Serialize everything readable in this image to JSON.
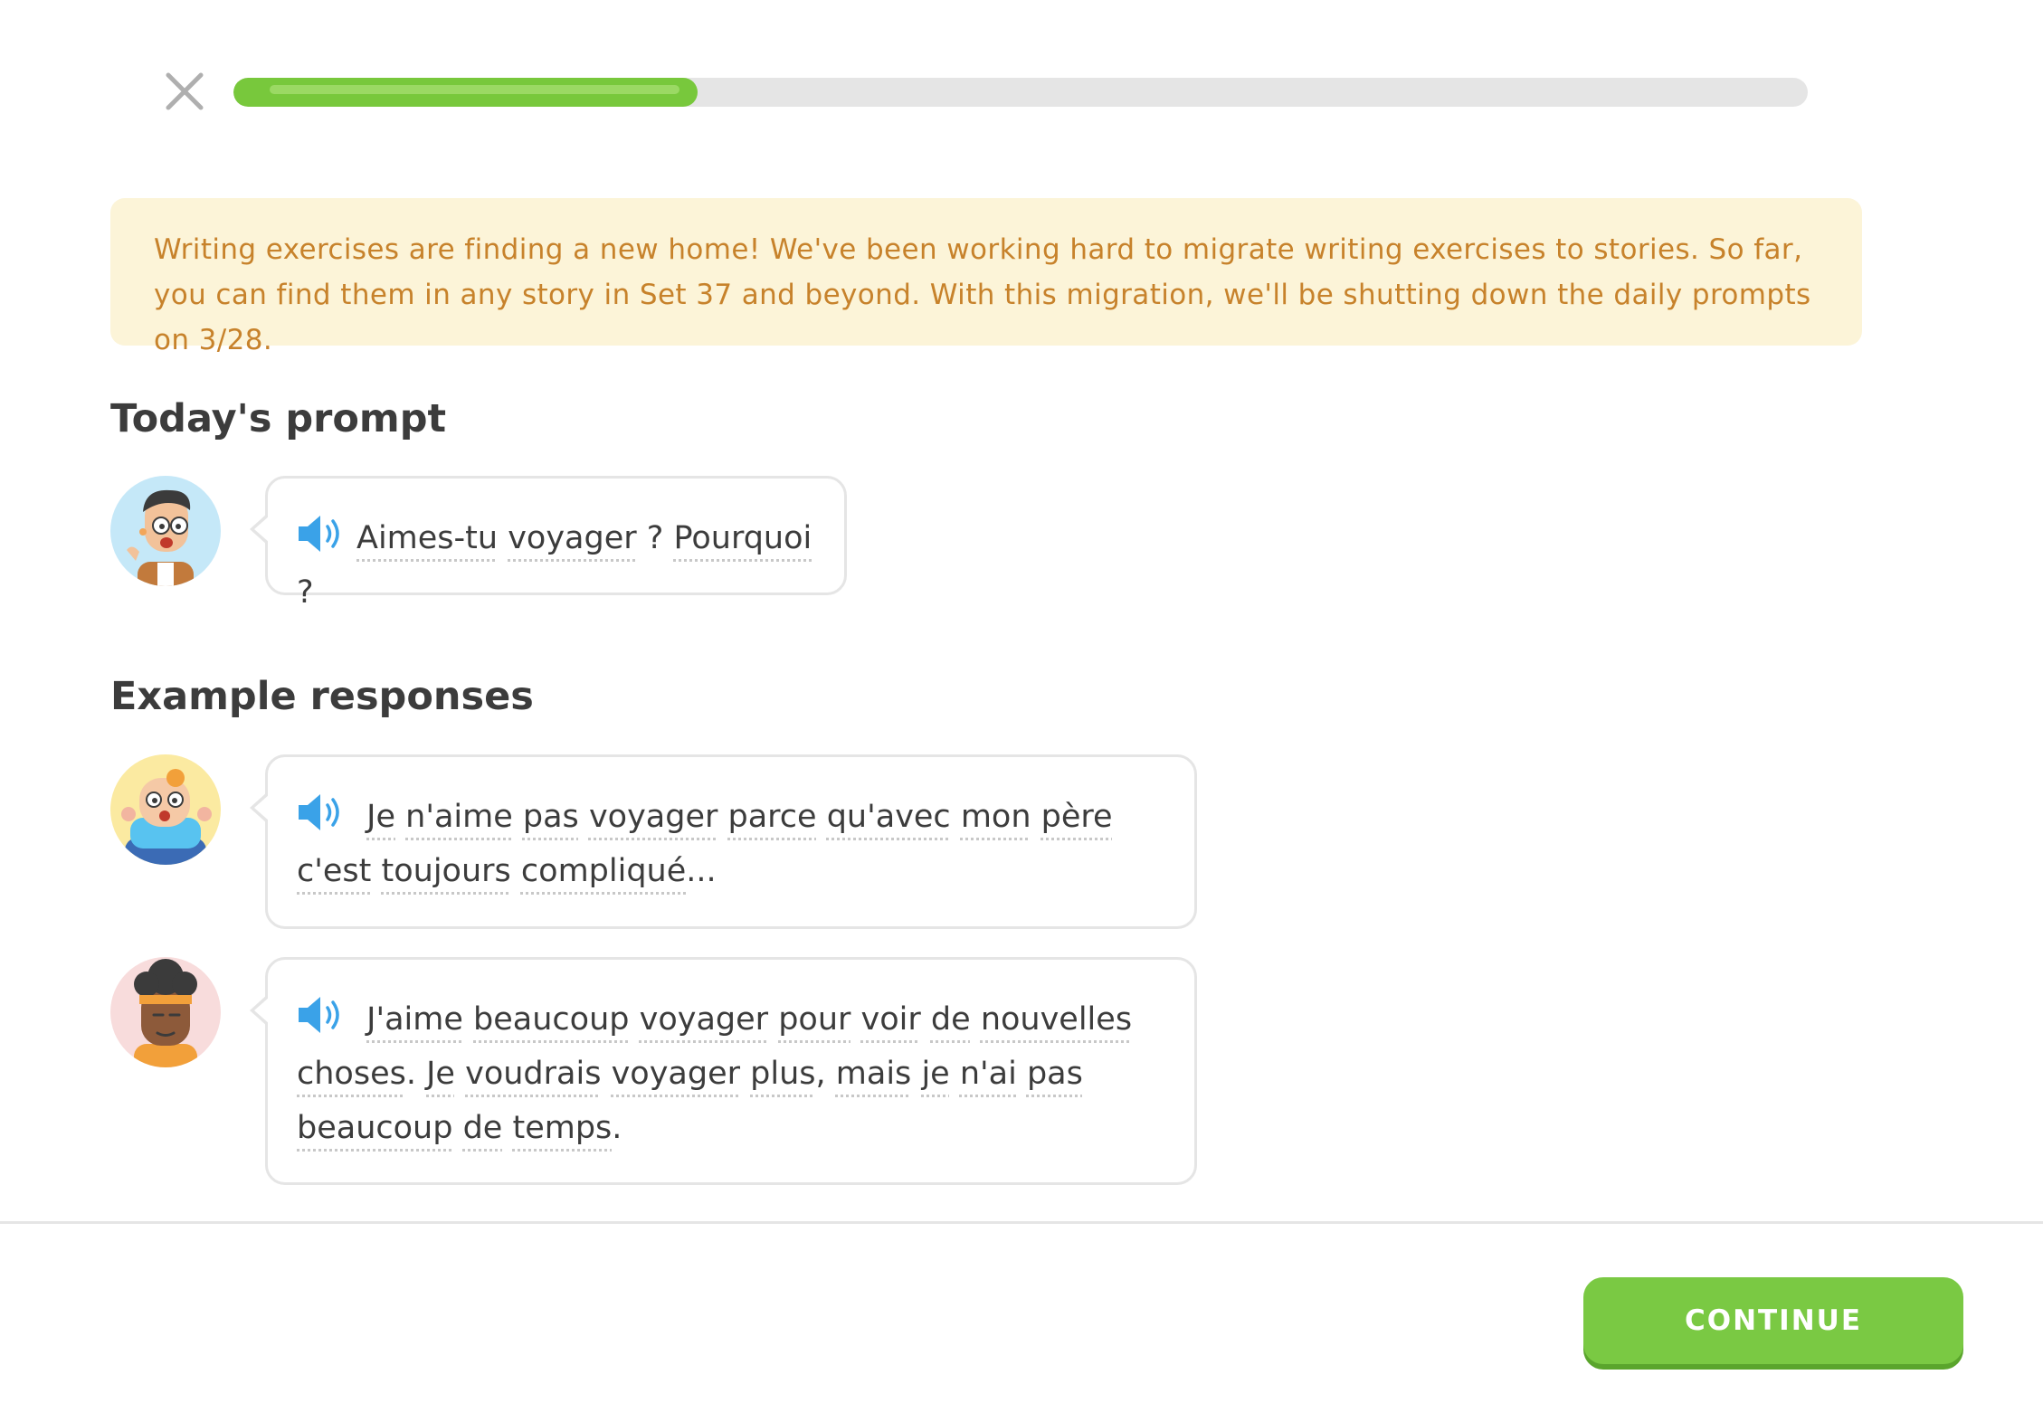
{
  "header": {
    "close_icon": "close-icon",
    "progress_fraction": 0.295,
    "progress_color": "#78c83c"
  },
  "banner": {
    "text": "Writing exercises are finding a new home! We've been working hard to migrate writing exercises to stories. So far, you can find them in any story in Set 37 and beyond. With this migration, we'll be shutting down the daily prompts on 3/28."
  },
  "prompt": {
    "title": "Today's prompt",
    "speaker_icon": "speaker-icon",
    "segments": [
      "Aimes-tu",
      " ",
      "voyager",
      " ? ",
      "Pourquoi",
      " ?"
    ]
  },
  "examples": {
    "title": "Example responses",
    "items": [
      {
        "avatar": "character-avatar-boy",
        "segments": [
          "Je",
          " ",
          "n'aime",
          " ",
          "pas",
          " ",
          "voyager",
          " ",
          "parce",
          " ",
          "qu'avec",
          " ",
          "mon",
          " ",
          "père",
          " ",
          "c'est",
          " ",
          "toujours",
          " ",
          "compliqué",
          "..."
        ]
      },
      {
        "avatar": "character-avatar-woman",
        "segments": [
          "J'aime",
          " ",
          "beaucoup",
          " ",
          "voyager",
          " ",
          "pour",
          " ",
          "voir",
          " ",
          "de",
          " ",
          "nouvelles",
          " ",
          "choses",
          ". ",
          "Je",
          " ",
          "voudrais",
          " ",
          "voyager",
          " ",
          "plus",
          ", ",
          "mais",
          " ",
          "je",
          " ",
          "n'ai",
          " ",
          "pas",
          " ",
          "beaucoup",
          " ",
          "de",
          " ",
          "temps",
          "."
        ]
      }
    ]
  },
  "footer": {
    "continue_label": "CONTINUE",
    "continue_color": "#7ac943"
  }
}
